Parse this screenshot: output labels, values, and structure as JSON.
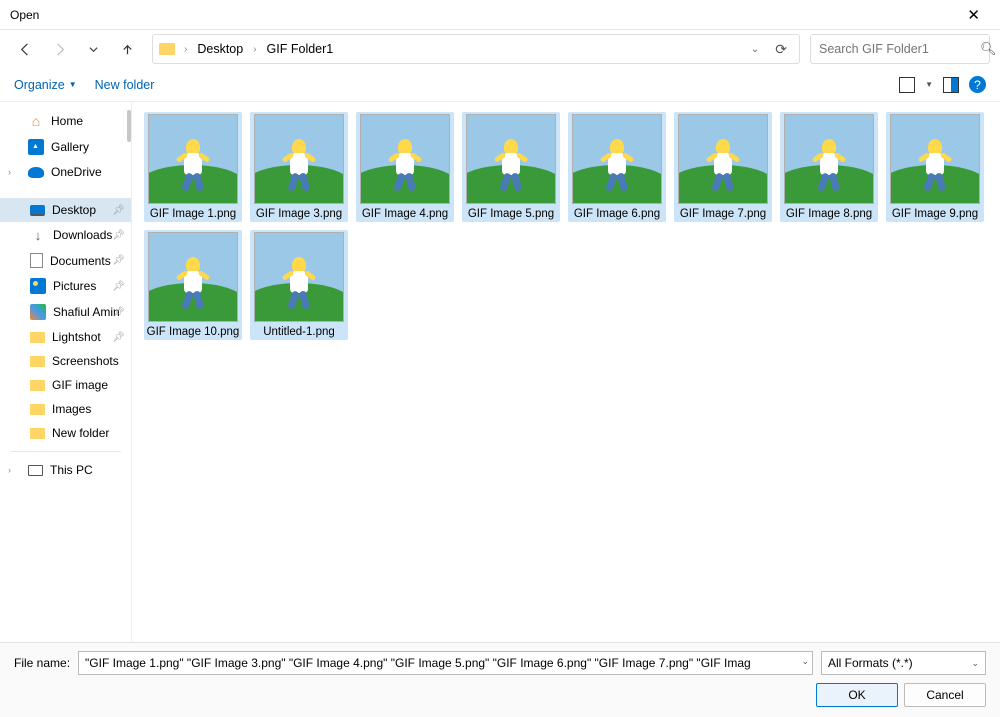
{
  "title": "Open",
  "breadcrumb": {
    "items": [
      "Desktop",
      "GIF Folder1"
    ]
  },
  "search": {
    "placeholder": "Search GIF Folder1"
  },
  "toolbar": {
    "organize": "Organize",
    "newfolder": "New folder"
  },
  "sidebar": {
    "home": "Home",
    "gallery": "Gallery",
    "onedrive": "OneDrive",
    "desktop": "Desktop",
    "downloads": "Downloads",
    "documents": "Documents",
    "pictures": "Pictures",
    "user": "Shafiul Amin",
    "lightshot": "Lightshot",
    "screenshots": "Screenshots",
    "gifimage": "GIF image",
    "images": "Images",
    "newfolder": "New folder",
    "thispc": "This PC"
  },
  "files": [
    {
      "name": "GIF Image 1.png",
      "sel": true
    },
    {
      "name": "GIF Image 3.png",
      "sel": true
    },
    {
      "name": "GIF Image 4.png",
      "sel": true
    },
    {
      "name": "GIF Image 5.png",
      "sel": true
    },
    {
      "name": "GIF Image 6.png",
      "sel": true
    },
    {
      "name": "GIF Image 7.png",
      "sel": true
    },
    {
      "name": "GIF Image 8.png",
      "sel": true
    },
    {
      "name": "GIF Image 9.png",
      "sel": true
    },
    {
      "name": "GIF Image 10.png",
      "sel": true
    },
    {
      "name": "Untitled-1.png",
      "sel": true
    }
  ],
  "footer": {
    "label": "File name:",
    "value": "\"GIF Image 1.png\" \"GIF Image 3.png\" \"GIF Image 4.png\" \"GIF Image 5.png\" \"GIF Image 6.png\" \"GIF Image 7.png\" \"GIF Imag",
    "filter": "All Formats (*.*)",
    "ok": "OK",
    "cancel": "Cancel"
  }
}
